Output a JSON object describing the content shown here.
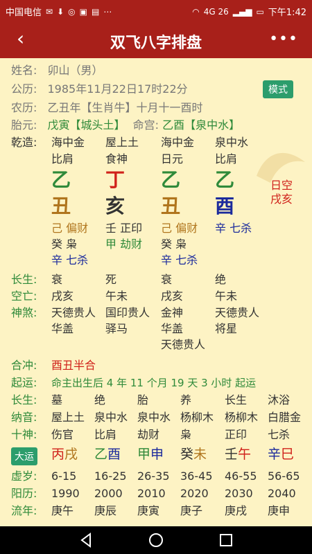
{
  "status": {
    "carrier": "中国电信",
    "time": "下午1:42",
    "network": "4G 26"
  },
  "app": {
    "title": "双飞八字排盘"
  },
  "person": {
    "name_label": "姓名:",
    "name_value": "卯山（男）",
    "gongli_label": "公历:",
    "gongli_value": "1985年11月22日17时22分",
    "mode_label": "模式",
    "nongli_label": "农历:",
    "nongli_value": "乙丑年【生肖牛】十月十一酉时",
    "taiyuan_label": "胎元:",
    "taiyuan_value": "戊寅【城头土】",
    "minggong_label": "命宫:",
    "minggong_value": "乙酉【泉中水】"
  },
  "qianzao": {
    "label": "乾造:",
    "nayin": [
      "海中金",
      "屋上土",
      "海中金",
      "泉中水"
    ],
    "shishen": [
      "比肩",
      "食神",
      "日元",
      "比肩"
    ],
    "tiangan": [
      "乙",
      "丁",
      "乙",
      "乙"
    ],
    "dizhi": [
      "丑",
      "亥",
      "丑",
      "酉"
    ],
    "rikong_1": "日空",
    "rikong_2": "戌亥",
    "canggan": [
      [
        "己 偏财",
        "癸 枭",
        "辛 七杀"
      ],
      [
        "壬 正印",
        "甲 劫财"
      ],
      [
        "己 偏财",
        "癸 枭",
        "辛 七杀"
      ],
      [
        "辛 七杀"
      ]
    ]
  },
  "rows": {
    "changsheng_label": "长生:",
    "changsheng": [
      "衰",
      "死",
      "衰",
      "绝"
    ],
    "kongwang_label": "空亡:",
    "kongwang": [
      "戌亥",
      "午未",
      "戌亥",
      "午未"
    ],
    "shensha_label": "神煞:",
    "shensha": [
      [
        "天德贵人",
        "华盖"
      ],
      [
        "国印贵人",
        "驿马"
      ],
      [
        "金神",
        "华盖",
        "天德贵人"
      ],
      [
        "天德贵人",
        "将星"
      ]
    ]
  },
  "hechong": {
    "label": "合冲:",
    "value": "酉丑半合"
  },
  "qiyun": {
    "label": "起运:",
    "value": "命主出生后 4 年 11 个月 19 天 3 小时 起运"
  },
  "dayun_table": {
    "changsheng_label": "长生:",
    "changsheng": [
      "墓",
      "绝",
      "胎",
      "养",
      "长生",
      "沐浴"
    ],
    "nayin_label": "纳音:",
    "nayin": [
      "屋上土",
      "泉中水",
      "泉中水",
      "杨柳木",
      "杨柳木",
      "白腊金"
    ],
    "shishen_label": "十神:",
    "shishen": [
      "伤官",
      "比肩",
      "劫财",
      "枭",
      "正印",
      "七杀"
    ],
    "dayun_label": "大运",
    "dayun_gan": [
      "丙",
      "乙",
      "甲",
      "癸",
      "壬",
      "辛"
    ],
    "dayun_zhi": [
      "戌",
      "酉",
      "申",
      "未",
      "午",
      "巳"
    ],
    "xusui_label": "虚岁:",
    "xusui": [
      "6-15",
      "16-25",
      "26-35",
      "36-45",
      "46-55",
      "56-65"
    ],
    "yangli_label": "阳历:",
    "yangli": [
      "1990",
      "2000",
      "2010",
      "2020",
      "2030",
      "2040"
    ],
    "liunian_label": "流年:",
    "liunian": [
      "庚午",
      "庚辰",
      "庚寅",
      "庚子",
      "庚戌",
      "庚申"
    ]
  },
  "colors": {
    "header": "#a8201a",
    "background": "#fdf3c4",
    "label_green": "#2f8a3a",
    "badge": "#2c9d6c"
  }
}
